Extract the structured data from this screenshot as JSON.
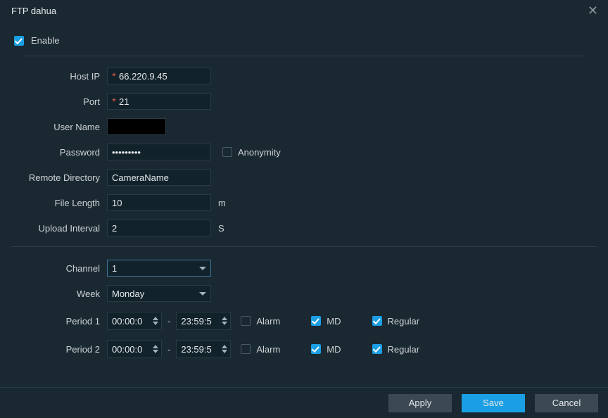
{
  "title": "FTP dahua",
  "enable": {
    "label": "Enable",
    "checked": true
  },
  "fields": {
    "host_ip": {
      "label": "Host IP",
      "value": "66.220.9.45",
      "required": true
    },
    "port": {
      "label": "Port",
      "value": "21",
      "required": true
    },
    "user_name": {
      "label": "User Name",
      "value": ""
    },
    "password": {
      "label": "Password",
      "value": "•••••••••"
    },
    "anonymity": {
      "label": "Anonymity",
      "checked": false
    },
    "remote_dir": {
      "label": "Remote Directory",
      "value": "CameraName"
    },
    "file_len": {
      "label": "File Length",
      "value": "10",
      "unit": "m"
    },
    "upload_int": {
      "label": "Upload Interval",
      "value": "2",
      "unit": "S"
    }
  },
  "channel": {
    "label": "Channel",
    "value": "1"
  },
  "week": {
    "label": "Week",
    "value": "Monday"
  },
  "periods": [
    {
      "label": "Period 1",
      "start": "00:00:0",
      "end": "23:59:5",
      "alarm": {
        "label": "Alarm",
        "checked": false
      },
      "md": {
        "label": "MD",
        "checked": true
      },
      "regular": {
        "label": "Regular",
        "checked": true
      }
    },
    {
      "label": "Period 2",
      "start": "00:00:0",
      "end": "23:59:5",
      "alarm": {
        "label": "Alarm",
        "checked": false
      },
      "md": {
        "label": "MD",
        "checked": true
      },
      "regular": {
        "label": "Regular",
        "checked": true
      }
    }
  ],
  "buttons": {
    "apply": "Apply",
    "save": "Save",
    "cancel": "Cancel"
  }
}
